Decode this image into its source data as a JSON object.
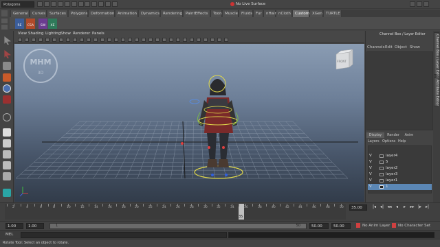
{
  "status_line": {
    "menu_set": "Polygons",
    "live_surface": "No Live Surface"
  },
  "shelf_tabs": [
    "General",
    "Curves",
    "Surfaces",
    "Polygons",
    "Deformation",
    "Animation",
    "Dynamics",
    "Rendering",
    "PaintEffects",
    "Toon",
    "Muscle",
    "Fluids",
    "Fur",
    "nHair",
    "nCloth",
    "Custom",
    "XGen",
    "TURTLE"
  ],
  "active_shelf_tab": "Custom",
  "shelf_buttons": [
    "RE",
    "CSA",
    "SW",
    "XE"
  ],
  "viewport": {
    "menus": [
      "View",
      "Shading",
      "Lighting",
      "Show",
      "Renderer",
      "Panels"
    ],
    "view_cube_label": "FRONT",
    "watermark_title": "MHM",
    "watermark_sub": "3D"
  },
  "channel_box": {
    "title": "Channel Box / Layer Editor",
    "menus": [
      "Channels",
      "Edit",
      "Object",
      "Show"
    ],
    "side_tabs": [
      "Channel Box / Layer Editor",
      "Attribute Editor"
    ]
  },
  "layer_editor": {
    "tabs": [
      "Display",
      "Render",
      "Anim"
    ],
    "menus": [
      "Layers",
      "Options",
      "Help"
    ],
    "layers": [
      {
        "vis": "V",
        "name": "layer4",
        "selected": false
      },
      {
        "vis": "V",
        "name": "5",
        "selected": false
      },
      {
        "vis": "V",
        "name": "layer2",
        "selected": false
      },
      {
        "vis": "V",
        "name": "layer3",
        "selected": false
      },
      {
        "vis": "V",
        "name": "layer1",
        "selected": false
      },
      {
        "vis": "V",
        "name": "1",
        "selected": true
      }
    ]
  },
  "time_slider": {
    "tick_labels": [
      "2",
      "4",
      "6",
      "8",
      "10",
      "12",
      "14",
      "16",
      "18",
      "20",
      "22",
      "24",
      "26",
      "28",
      "30",
      "32",
      "34",
      "36",
      "38",
      "40",
      "42",
      "44",
      "46",
      "48",
      "50"
    ],
    "current_frame_marker": "35",
    "current_frame_field": "35.00"
  },
  "range_slider": {
    "start_time": "1.00",
    "range_start": "1.00",
    "range_inner_start": "1",
    "range_inner_end": "50",
    "range_end": "50.00",
    "end_time": "50.00",
    "anim_layer": "No Anim Layer",
    "character_set": "No Character Set"
  },
  "command_line": {
    "label": "MEL"
  },
  "help_line": {
    "text": "Rotate Tool: Select an object to rotate."
  },
  "colors": {
    "active_tab": "#6e6e6e",
    "selected_layer": "#5b87b5",
    "current_frame": "#c0c0c0",
    "sky_top": "#8a9cb3",
    "floor": "#323c4a"
  }
}
